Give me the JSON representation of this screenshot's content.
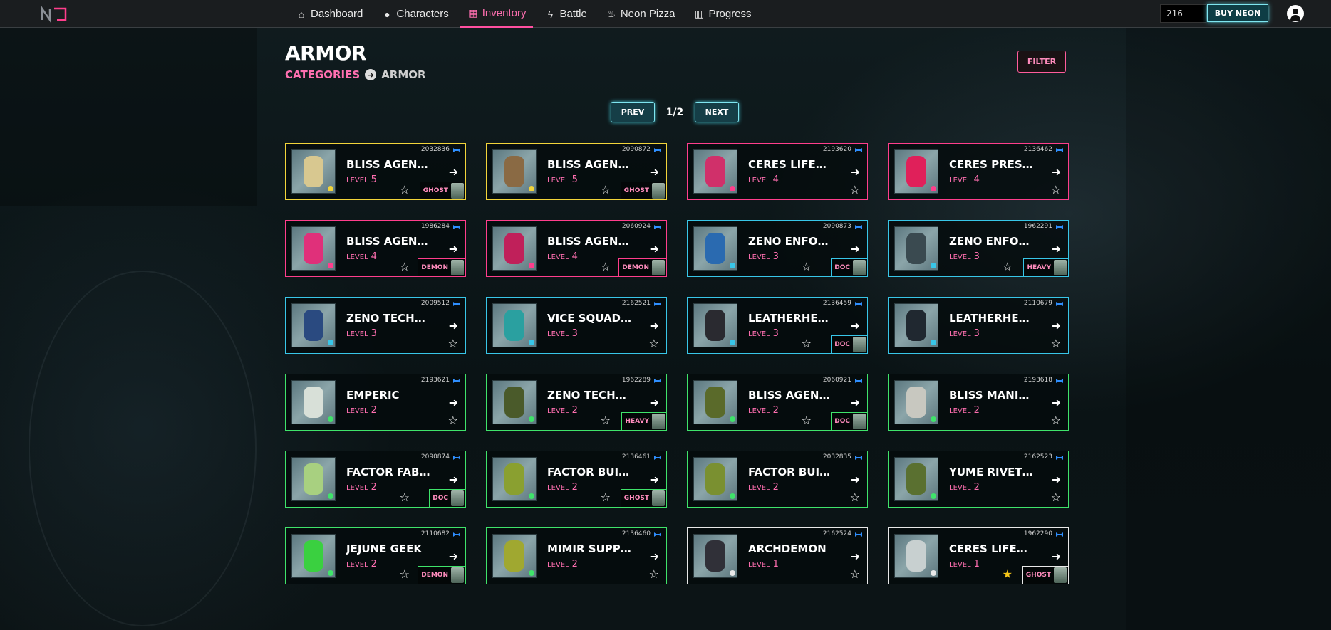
{
  "nav": {
    "items": [
      {
        "label": "Dashboard",
        "icon": "home-icon"
      },
      {
        "label": "Characters",
        "icon": "user-icon"
      },
      {
        "label": "Inventory",
        "icon": "grid-icon",
        "active": true
      },
      {
        "label": "Battle",
        "icon": "bolt-icon"
      },
      {
        "label": "Neon Pizza",
        "icon": "flame-icon"
      },
      {
        "label": "Progress",
        "icon": "bar-chart-icon"
      }
    ],
    "coin_value": "216",
    "buy_label": "BUY NEON"
  },
  "header": {
    "title": "ARMOR",
    "breadcrumb_link": "CATEGORIES",
    "breadcrumb_current": "ARMOR",
    "filter_label": "FILTER"
  },
  "pager": {
    "prev_label": "PREV",
    "page": "1/2",
    "next_label": "NEXT"
  },
  "level_label": "LEVEL",
  "colors": {
    "legendary": "#f2d43a",
    "epic": "#ff3e8c",
    "rare": "#38c6e8",
    "uncommon": "#3fe36a",
    "common": "#e8e8e8",
    "accent": "#ff6fb0"
  },
  "items": [
    {
      "id": "2032836",
      "name": "BLISS AGENT: ...",
      "level": "5",
      "rarity": "legendary",
      "class": "GHOST",
      "starred": false,
      "art": "#d8c890"
    },
    {
      "id": "2090872",
      "name": "BLISS AGENT: ...",
      "level": "5",
      "rarity": "legendary",
      "class": "GHOST",
      "starred": false,
      "art": "#8a6a44"
    },
    {
      "id": "2193620",
      "name": "CERES LIFEGIV...",
      "level": "4",
      "rarity": "epic",
      "class": "",
      "starred": false,
      "art": "#d0306a"
    },
    {
      "id": "2136462",
      "name": "CERES PRESERV...",
      "level": "4",
      "rarity": "epic",
      "class": "",
      "starred": false,
      "art": "#e0205a"
    },
    {
      "id": "1986284",
      "name": "BLISS AGENT: ...",
      "level": "4",
      "rarity": "epic",
      "class": "DEMON",
      "starred": false,
      "art": "#e0307a"
    },
    {
      "id": "2060924",
      "name": "BLISS AGENT: ...",
      "level": "4",
      "rarity": "epic",
      "class": "DEMON",
      "starred": false,
      "art": "#c0205a"
    },
    {
      "id": "2090873",
      "name": "ZENO ENFORCER...",
      "level": "3",
      "rarity": "rare",
      "class": "DOC",
      "starred": false,
      "art": "#2a6ab0"
    },
    {
      "id": "1962291",
      "name": "ZENO ENFORCER...",
      "level": "3",
      "rarity": "rare",
      "class": "HEAVY",
      "starred": false,
      "art": "#3a4a50"
    },
    {
      "id": "2009512",
      "name": "ZENO TECHNICI...",
      "level": "3",
      "rarity": "rare",
      "class": "",
      "starred": false,
      "art": "#2a4a80"
    },
    {
      "id": "2162521",
      "name": "VICE SQUAD MA...",
      "level": "3",
      "rarity": "rare",
      "class": "",
      "starred": false,
      "art": "#2aa0a0"
    },
    {
      "id": "2136459",
      "name": "LEATHERHEADZ ...",
      "level": "3",
      "rarity": "rare",
      "class": "DOC",
      "starred": false,
      "art": "#2a2a30"
    },
    {
      "id": "2110679",
      "name": "LEATHERHEADZ ...",
      "level": "3",
      "rarity": "rare",
      "class": "",
      "starred": false,
      "art": "#202830"
    },
    {
      "id": "2193621",
      "name": "EMPERIC",
      "level": "2",
      "rarity": "uncommon",
      "class": "",
      "starred": false,
      "art": "#d8e0d8"
    },
    {
      "id": "1962289",
      "name": "ZENO TECHNICI...",
      "level": "2",
      "rarity": "uncommon",
      "class": "HEAVY",
      "starred": false,
      "art": "#4a5a2a"
    },
    {
      "id": "2060921",
      "name": "BLISS AGENT: ...",
      "level": "2",
      "rarity": "uncommon",
      "class": "DOC",
      "starred": false,
      "art": "#5a6a2a"
    },
    {
      "id": "2193618",
      "name": "BLISS MANIPUL...",
      "level": "2",
      "rarity": "uncommon",
      "class": "",
      "starred": false,
      "art": "#c8c8c0"
    },
    {
      "id": "2090874",
      "name": "FACTOR FABRIC...",
      "level": "2",
      "rarity": "uncommon",
      "class": "DOC",
      "starred": false,
      "art": "#a8d080"
    },
    {
      "id": "2136461",
      "name": "FACTOR BUILDE...",
      "level": "2",
      "rarity": "uncommon",
      "class": "GHOST",
      "starred": false,
      "art": "#8aa030"
    },
    {
      "id": "2032835",
      "name": "FACTOR BUILDE...",
      "level": "2",
      "rarity": "uncommon",
      "class": "",
      "starred": false,
      "art": "#7a9030"
    },
    {
      "id": "2162523",
      "name": "YUME RIVETER:...",
      "level": "2",
      "rarity": "uncommon",
      "class": "",
      "starred": false,
      "art": "#5a7030"
    },
    {
      "id": "2110682",
      "name": "JEJUNE GEEK",
      "level": "2",
      "rarity": "uncommon",
      "class": "DEMON",
      "starred": false,
      "art": "#3ad040"
    },
    {
      "id": "2136460",
      "name": "MIMIR SUPPORT",
      "level": "2",
      "rarity": "uncommon",
      "class": "",
      "starred": false,
      "art": "#a0a830"
    },
    {
      "id": "2162524",
      "name": "ARCHDEMON",
      "level": "1",
      "rarity": "common",
      "class": "",
      "starred": false,
      "art": "#303038"
    },
    {
      "id": "1962290",
      "name": "CERES LIFEGIV...",
      "level": "1",
      "rarity": "common",
      "class": "GHOST",
      "starred": true,
      "art": "#c8d0d0"
    }
  ]
}
